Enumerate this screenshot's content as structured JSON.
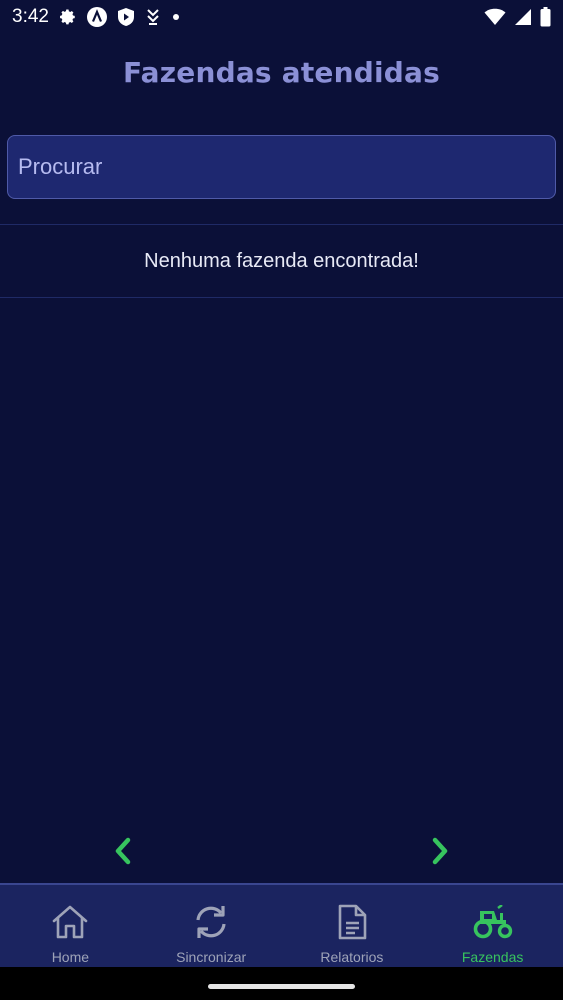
{
  "status_bar": {
    "time": "3:42",
    "left_icons": [
      "settings-gear-icon",
      "app-a-icon",
      "shield-play-icon",
      "download-badge-icon",
      "notification-dot-icon"
    ],
    "right_icons": [
      "wifi-icon",
      "cell-signal-icon",
      "battery-icon"
    ]
  },
  "page": {
    "title": "Fazendas atendidas"
  },
  "search": {
    "placeholder": "Procurar",
    "value": ""
  },
  "list": {
    "empty_message": "Nenhuma fazenda encontrada!"
  },
  "pagination": {
    "prev_icon": "chevron-left-icon",
    "next_icon": "chevron-right-icon",
    "accent_color": "#37c45e"
  },
  "bottom_nav": {
    "items": [
      {
        "label": "Home",
        "icon": "home-icon",
        "active": false
      },
      {
        "label": "Sincronizar",
        "icon": "sync-icon",
        "active": false
      },
      {
        "label": "Relatorios",
        "icon": "document-icon",
        "active": false
      },
      {
        "label": "Fazendas",
        "icon": "tractor-icon",
        "active": true
      }
    ]
  },
  "colors": {
    "background": "#0b1038",
    "title": "#8b90d6",
    "search_bg": "#1e2870",
    "nav_bg": "#1b2460",
    "active": "#37c45e",
    "inactive": "#9ea3b8"
  }
}
